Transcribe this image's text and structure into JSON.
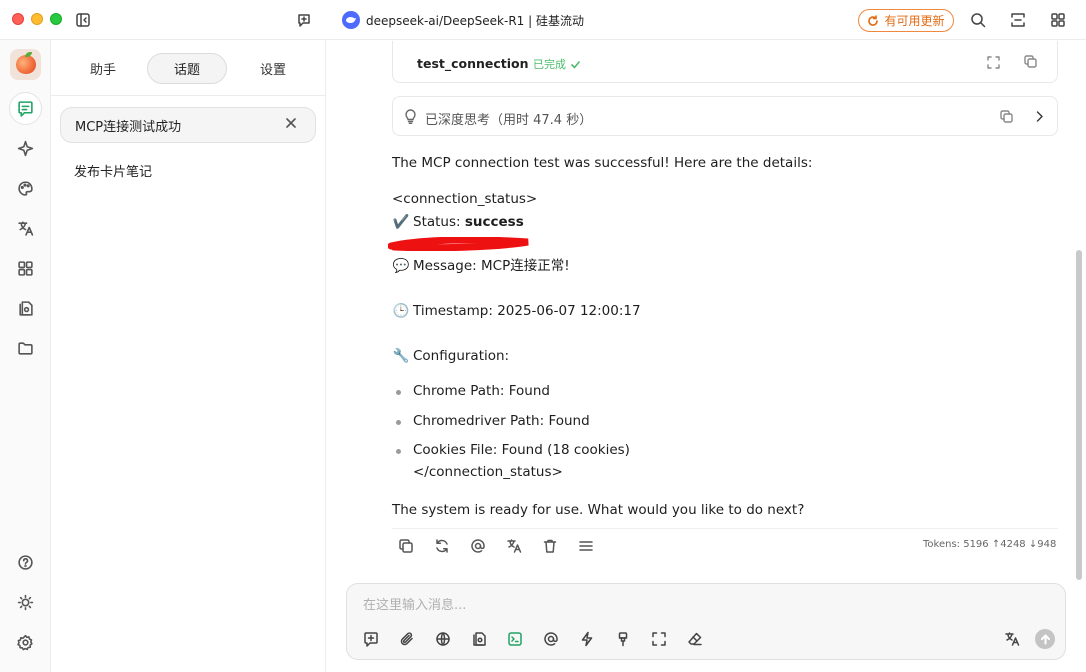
{
  "window": {
    "title": "deepseek-ai/DeepSeek-R1 | 硅基流动",
    "update_label": "有可用更新"
  },
  "sidebar_tabs": [
    {
      "label": "助手"
    },
    {
      "label": "话题"
    },
    {
      "label": "设置"
    }
  ],
  "topics": [
    {
      "label": "MCP连接测试成功"
    },
    {
      "label": "发布卡片笔记"
    }
  ],
  "tool_call": {
    "name": "test_connection",
    "status": "已完成"
  },
  "thinking": {
    "label": "已深度思考（用时 47.4 秒）"
  },
  "message": {
    "intro": "The MCP connection test was successful! Here are the details:",
    "open_tag": "<connection_status>",
    "status_emoji": "✔️",
    "status_label": "Status:",
    "status_value": "success",
    "message_emoji": "💬",
    "message_text": "Message: MCP连接正常!",
    "timestamp_emoji": "🕒",
    "timestamp_text": "Timestamp: 2025-06-07 12:00:17",
    "config_emoji": "🔧",
    "config_label": "Configuration:",
    "config_items": [
      {
        "text": "Chrome Path: Found"
      },
      {
        "text": "Chromedriver Path: Found"
      },
      {
        "text": "Cookies File: Found (18 cookies)"
      }
    ],
    "close_tag": "</connection_status>",
    "outro": "The system is ready for use. What would you like to do next?",
    "tokens": "Tokens: 5196 ↑4248 ↓948"
  },
  "input": {
    "placeholder": "在这里输入消息..."
  },
  "colors": {
    "accent": "#1fa463",
    "update": "#e36a12",
    "annotation": "#ee1111"
  }
}
